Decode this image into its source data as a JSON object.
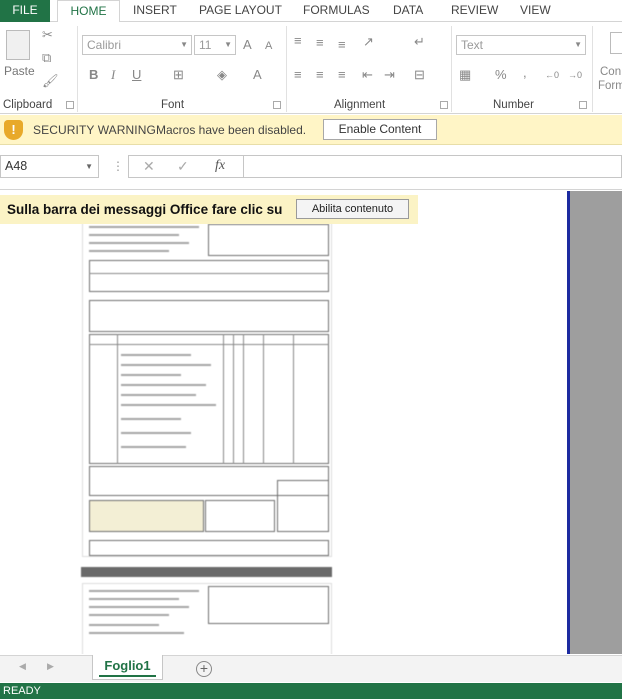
{
  "ribbon_tabs": {
    "file": "FILE",
    "home": "HOME",
    "insert": "INSERT",
    "page_layout": "PAGE LAYOUT",
    "formulas": "FORMULAS",
    "data": "DATA",
    "review": "REVIEW",
    "view": "VIEW"
  },
  "ribbon": {
    "clipboard": {
      "label": "Clipboard",
      "paste": "Paste"
    },
    "font": {
      "label": "Font",
      "name": "Calibri",
      "size": "11",
      "bold": "B",
      "italic": "I",
      "underline": "U",
      "grow": "A",
      "shrink": "A",
      "color": "A"
    },
    "alignment": {
      "label": "Alignment"
    },
    "number": {
      "label": "Number",
      "format": "Text",
      "percent": "%",
      "comma": ","
    },
    "styles": {
      "conditional_line1": "Con",
      "conditional_line2": "Form"
    }
  },
  "security_bar": {
    "title": "SECURITY WARNING",
    "message": "Macros have been disabled.",
    "button": "Enable Content"
  },
  "formula_bar": {
    "name_box": "A48",
    "fx": "fx",
    "formula": ""
  },
  "sheet": {
    "note_text": "Sulla barra dei messaggi Office fare clic su",
    "note_button": "Abilita contenuto"
  },
  "sheet_tabs": {
    "active": "Foglio1"
  },
  "status_bar": {
    "text": "READY"
  },
  "colors": {
    "excel_green": "#217346",
    "warning_bar": "#fff5c6",
    "note_highlight": "#fbf3c5",
    "right_border": "#1c2aa0"
  }
}
